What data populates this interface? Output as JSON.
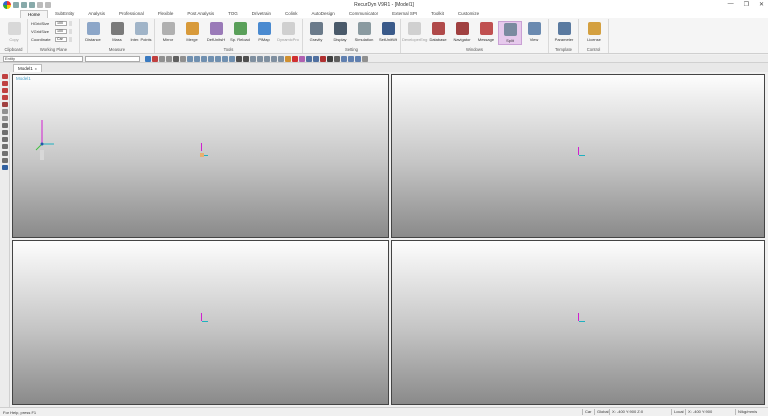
{
  "window": {
    "title": "RecurDyn V9R1 - [Model1]",
    "controls": [
      "—",
      "❐",
      "✕"
    ]
  },
  "ribbon_tabs": [
    {
      "label": "Home",
      "active": true
    },
    {
      "label": "SubEntity"
    },
    {
      "label": "Analysis"
    },
    {
      "label": "Professional"
    },
    {
      "label": "Flexible"
    },
    {
      "label": "Post Analysis"
    },
    {
      "label": "TOG"
    },
    {
      "label": "Drivetrain"
    },
    {
      "label": "Colink"
    },
    {
      "label": "AutoDesign"
    },
    {
      "label": "Communicator"
    },
    {
      "label": "External SPI"
    },
    {
      "label": "Toolkit"
    },
    {
      "label": "Customize"
    }
  ],
  "groups": {
    "clipboard": {
      "label": "Clipboard",
      "copy": "Copy"
    },
    "working_plane": {
      "label": "Working Plane",
      "grid_size_h_label": "HGridSize",
      "grid_size_h": "100",
      "grid_size_v_label": "VGridSize",
      "grid_size_v": "100",
      "coordinate_label": "Coordinate",
      "coordinate": "Car"
    },
    "measure": {
      "label": "Measure",
      "buttons": [
        "Distance",
        "Mass",
        "Inter. Points"
      ]
    },
    "tools": {
      "label": "Tools",
      "buttons": [
        "Mirror",
        "Merge",
        "DefUnitsH",
        "Sp. Reload",
        "PlMap",
        "DynamicPro"
      ]
    },
    "setting": {
      "label": "Setting",
      "buttons": [
        "Gravity",
        "Display",
        "Simulation",
        "SetUnitWt"
      ]
    },
    "windows": {
      "label": "Windows",
      "buttons": [
        "DeveloperEng",
        "Database",
        "Navigator",
        "Message",
        "Split",
        "View"
      ]
    },
    "template": {
      "label": "Template",
      "buttons": [
        "Parameter"
      ]
    },
    "control": {
      "label": "Control",
      "buttons": [
        "License"
      ]
    }
  },
  "toolbar": {
    "entity_value": "Entity"
  },
  "doc_tab": {
    "label": "Model1",
    "close": "x"
  },
  "viewports": [
    {
      "name": "viewport-top-left",
      "label": "Model1"
    },
    {
      "name": "viewport-top-right",
      "label": ""
    },
    {
      "name": "viewport-bottom-left",
      "label": ""
    },
    {
      "name": "viewport-bottom-right",
      "label": ""
    }
  ],
  "status": {
    "help": "For Help, press F1",
    "coord": "Car",
    "ref": "Global",
    "position": "X: -400 Y:900 Z:0",
    "local": "Local",
    "local_pos": "X: -400 Y:900",
    "units": "N/kg/mm/s"
  },
  "colors": {
    "viewport_label": "#4aa0c8",
    "axis_z": "#d020d0",
    "axis_y": "#20b0c0",
    "selected_button": "#e6c9ec"
  }
}
